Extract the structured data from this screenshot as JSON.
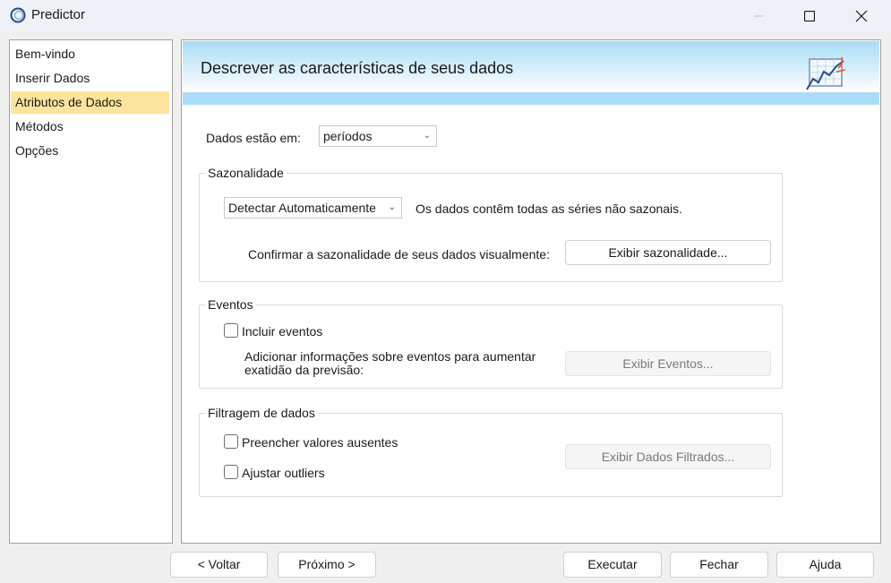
{
  "window": {
    "title": "Predictor",
    "minimize_icon": "minimize-icon",
    "maximize_icon": "maximize-icon",
    "close_icon": "close-icon"
  },
  "sidebar": {
    "items": [
      {
        "label": "Bem-vindo",
        "active": false
      },
      {
        "label": "Inserir Dados",
        "active": false
      },
      {
        "label": "Atributos de Dados",
        "active": true
      },
      {
        "label": "Métodos",
        "active": false
      },
      {
        "label": "Opções",
        "active": false
      }
    ]
  },
  "header": {
    "title": "Descrever as características de seus dados",
    "icon": "chart-trend-icon"
  },
  "data_in": {
    "label": "Dados estão em:",
    "value": "períodos"
  },
  "seasonality": {
    "title": "Sazonalidade",
    "select_value": "Detectar Automaticamente",
    "status_text": "Os dados contêm todas as séries não sazonais.",
    "confirm_label": "Confirmar a sazonalidade de seus dados visualmente:",
    "button_label": "Exibir sazonalidade..."
  },
  "events": {
    "title": "Eventos",
    "checkbox_label": "Incluir eventos",
    "checked": false,
    "description_line1": "Adicionar informações sobre eventos para aumentar",
    "description_line2": "exatidão da previsão:",
    "button_label": "Exibir Eventos..."
  },
  "filtering": {
    "title": "Filtragem de dados",
    "fill_missing_label": "Preencher valores ausentes",
    "fill_missing_checked": false,
    "adjust_outliers_label": "Ajustar outliers",
    "adjust_outliers_checked": false,
    "button_label": "Exibir Dados Filtrados..."
  },
  "footer": {
    "back_label": "< Voltar",
    "next_label": "Próximo >",
    "run_label": "Executar",
    "close_label": "Fechar",
    "help_label": "Ajuda"
  }
}
